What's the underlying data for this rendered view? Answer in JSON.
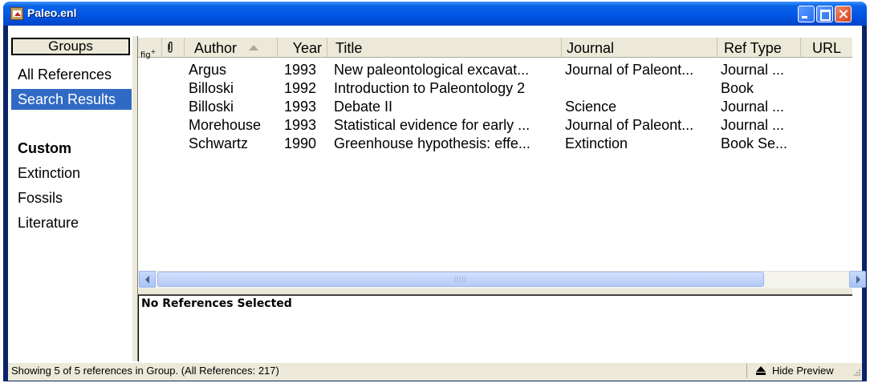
{
  "window": {
    "title": "Paleo.enl"
  },
  "groups": {
    "header": "Groups",
    "items": [
      {
        "label": "All References"
      },
      {
        "label": "Search Results"
      }
    ],
    "custom_label": "Custom",
    "custom_items": [
      {
        "label": "Extinction"
      },
      {
        "label": "Fossils"
      },
      {
        "label": "Literature"
      }
    ]
  },
  "list": {
    "header_icons": {
      "figure": "fig+",
      "attachment": "paperclip"
    },
    "columns": {
      "author": "Author",
      "year": "Year",
      "title": "Title",
      "journal": "Journal",
      "ref_type": "Ref Type",
      "url": "URL"
    },
    "rows": [
      {
        "author": "Argus",
        "year": "1993",
        "title": "New paleontological excavat...",
        "journal": "Journal of Paleont...",
        "ref_type": "Journal ..."
      },
      {
        "author": "Billoski",
        "year": "1992",
        "title": "Introduction to Paleontology 2",
        "journal": "",
        "ref_type": "Book"
      },
      {
        "author": "Billoski",
        "year": "1993",
        "title": "Debate II",
        "journal": "Science",
        "ref_type": "Journal ..."
      },
      {
        "author": "Morehouse",
        "year": "1993",
        "title": "Statistical evidence for early ...",
        "journal": "Journal of Paleont...",
        "ref_type": "Journal ..."
      },
      {
        "author": "Schwartz",
        "year": "1990",
        "title": "Greenhouse hypothesis: effe...",
        "journal": "Extinction",
        "ref_type": "Book Se..."
      }
    ]
  },
  "preview": {
    "text": "No References Selected"
  },
  "status": {
    "text": "Showing 5 of 5 references in Group. (All References: 217)",
    "hide_preview": "Hide Preview"
  },
  "colors": {
    "titlebar": "#0054e3",
    "selection": "#316ac5",
    "chrome": "#ece9d8"
  }
}
